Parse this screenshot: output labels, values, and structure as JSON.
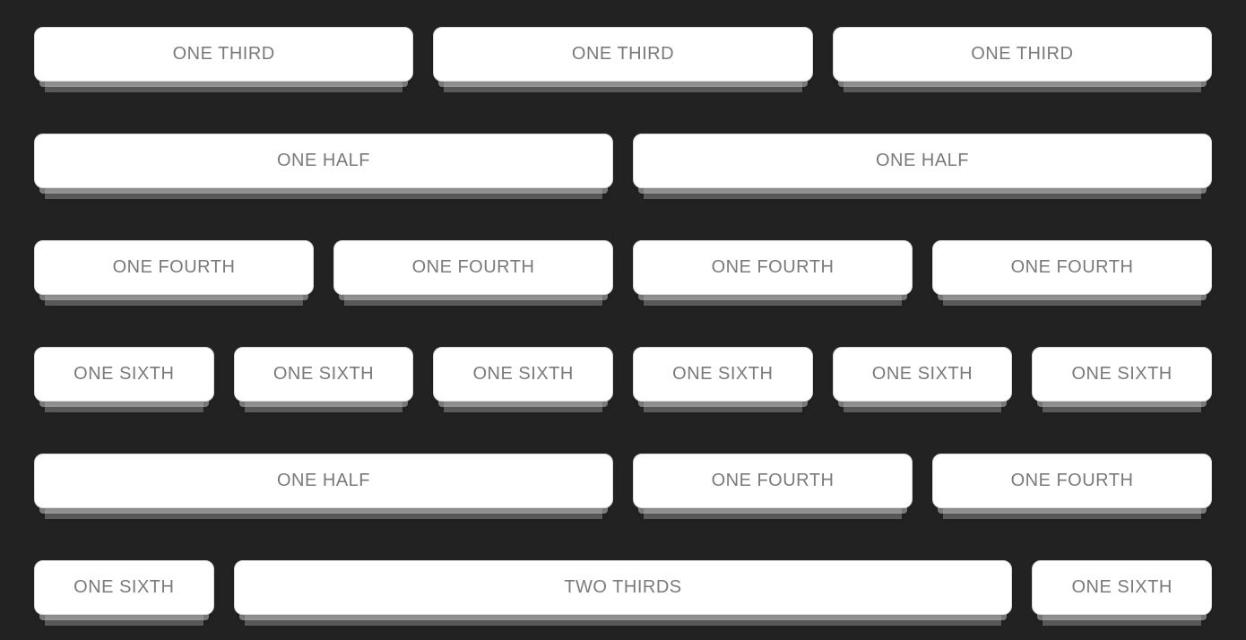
{
  "labels": {
    "one_third": "ONE THIRD",
    "one_half": "ONE HALF",
    "one_fourth": "ONE FOURTH",
    "one_sixth": "ONE SIXTH",
    "two_thirds": "TWO THIRDS"
  },
  "rows": [
    {
      "cols": [
        {
          "label_key": "one_third",
          "width": "1-3"
        },
        {
          "label_key": "one_third",
          "width": "1-3"
        },
        {
          "label_key": "one_third",
          "width": "1-3"
        }
      ]
    },
    {
      "cols": [
        {
          "label_key": "one_half",
          "width": "1-2"
        },
        {
          "label_key": "one_half",
          "width": "1-2"
        }
      ]
    },
    {
      "cols": [
        {
          "label_key": "one_fourth",
          "width": "1-4"
        },
        {
          "label_key": "one_fourth",
          "width": "1-4"
        },
        {
          "label_key": "one_fourth",
          "width": "1-4"
        },
        {
          "label_key": "one_fourth",
          "width": "1-4"
        }
      ]
    },
    {
      "cols": [
        {
          "label_key": "one_sixth",
          "width": "1-6"
        },
        {
          "label_key": "one_sixth",
          "width": "1-6"
        },
        {
          "label_key": "one_sixth",
          "width": "1-6"
        },
        {
          "label_key": "one_sixth",
          "width": "1-6"
        },
        {
          "label_key": "one_sixth",
          "width": "1-6"
        },
        {
          "label_key": "one_sixth",
          "width": "1-6"
        }
      ]
    },
    {
      "cols": [
        {
          "label_key": "one_half",
          "width": "1-2"
        },
        {
          "label_key": "one_fourth",
          "width": "1-4"
        },
        {
          "label_key": "one_fourth",
          "width": "1-4"
        }
      ]
    },
    {
      "cols": [
        {
          "label_key": "one_sixth",
          "width": "1-6"
        },
        {
          "label_key": "two_thirds",
          "width": "2-3"
        },
        {
          "label_key": "one_sixth",
          "width": "1-6"
        }
      ]
    }
  ]
}
